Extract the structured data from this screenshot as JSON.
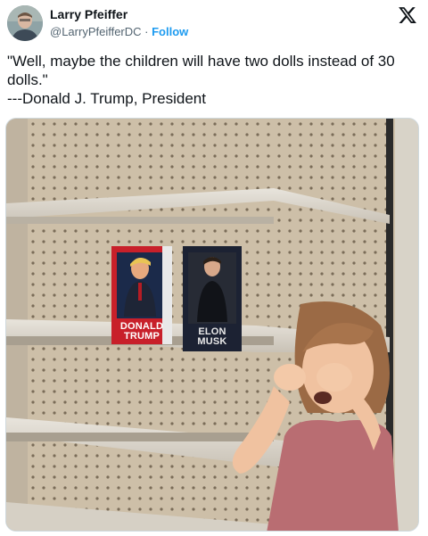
{
  "author": {
    "name": "Larry Pfeiffer",
    "handle": "@LarryPfeifferDC",
    "separator": " · ",
    "follow_label": "Follow"
  },
  "brand_icon": "x-logo-icon",
  "tweet": {
    "text": "\"Well, maybe the children will have two dolls instead of 30 dolls.\"\n---Donald J. Trump, President"
  },
  "photo": {
    "box_left_label": "DONALD\nTRUMP",
    "box_right_label": "ELON\nMUSK"
  },
  "colors": {
    "link": "#1d9bf0",
    "text": "#0f1419",
    "secondary_text": "#536471"
  }
}
